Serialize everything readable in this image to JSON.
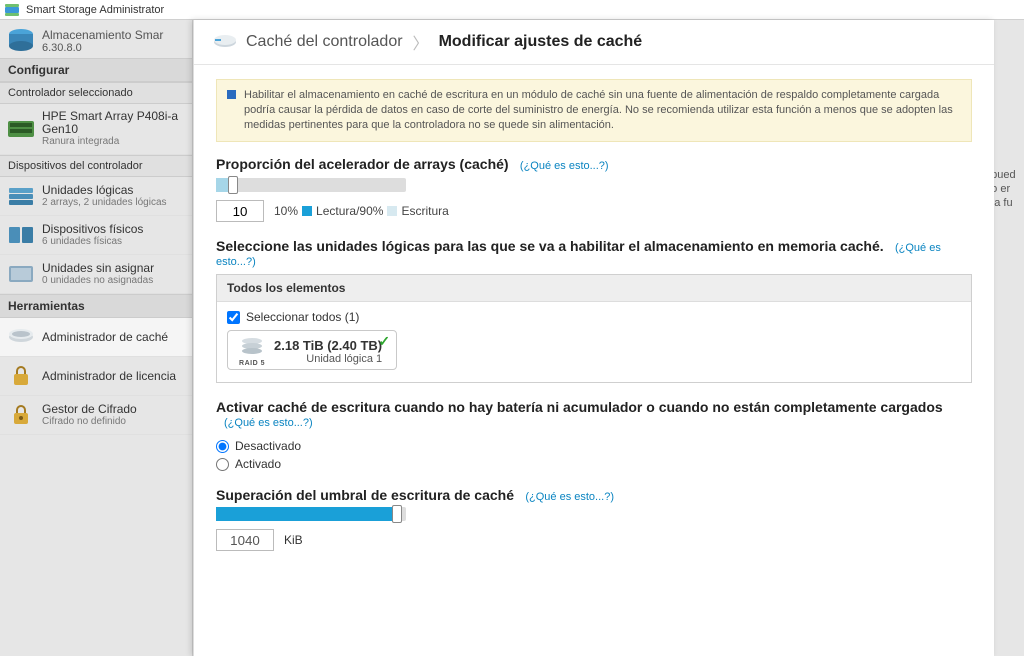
{
  "window": {
    "title": "Smart Storage Administrator"
  },
  "sidebar": {
    "product": {
      "name": "Almacenamiento Smar",
      "version": "6.30.8.0"
    },
    "configure_label": "Configurar",
    "controller_section": "Controlador seleccionado",
    "controller": {
      "name": "HPE Smart Array P408i-a",
      "gen": "Gen10",
      "slot": "Ranura integrada"
    },
    "devices_section": "Dispositivos del controlador",
    "items": [
      {
        "label": "Unidades lógicas",
        "sub": "2 arrays, 2 unidades lógicas"
      },
      {
        "label": "Dispositivos físicos",
        "sub": "6 unidades físicas"
      },
      {
        "label": "Unidades sin asignar",
        "sub": "0 unidades no asignadas"
      }
    ],
    "tools_section": "Herramientas",
    "tools": [
      {
        "label": "Administrador de caché",
        "sub": ""
      },
      {
        "label": "Administrador de licencia",
        "sub": ""
      },
      {
        "label": "Gestor de Cifrado",
        "sub": "Cifrado no definido"
      }
    ]
  },
  "peek": {
    "l1": "o pued",
    "l2": "nto er",
    "l3": "una fu"
  },
  "modal": {
    "crumb1": "Caché del controlador",
    "crumb2": "Modificar ajustes de caché",
    "alert": "Habilitar el almacenamiento en caché de escritura en un módulo de caché sin una fuente de alimentación de respaldo completamente cargada podría causar la pérdida de datos en caso de corte del suministro de energía. No se recomienda utilizar esta función a menos que se adopten las medidas pertinentes para que la controladora no se quede sin alimentación.",
    "ratio": {
      "title": "Proporción del acelerador de arrays (caché)",
      "help": "(¿Qué es esto...?)",
      "value": "10",
      "pct_read": "10%",
      "read_label": "Lectura",
      "slash": " / ",
      "pct_write": "90%",
      "write_label": "Escritura"
    },
    "select_ld": {
      "title": "Seleccione las unidades lógicas para las que se va a habilitar el almacenamiento en memoria caché.",
      "help": "(¿Qué es esto...?)",
      "panel_title": "Todos los elementos",
      "select_all": "Seleccionar todos (1)",
      "card": {
        "size": "2.18 TiB (2.40 TB)",
        "name": "Unidad lógica 1",
        "raid": "RAID 5"
      }
    },
    "nobatt": {
      "title": "Activar caché de escritura cuando no hay batería ni acumulador o cuando no están completamente cargados",
      "help": "(¿Qué es esto...?)",
      "off": "Desactivado",
      "on": "Activado"
    },
    "threshold": {
      "title": "Superación del umbral de escritura de caché",
      "help": "(¿Qué es esto...?)",
      "value": "1040",
      "unit": "KiB"
    }
  }
}
